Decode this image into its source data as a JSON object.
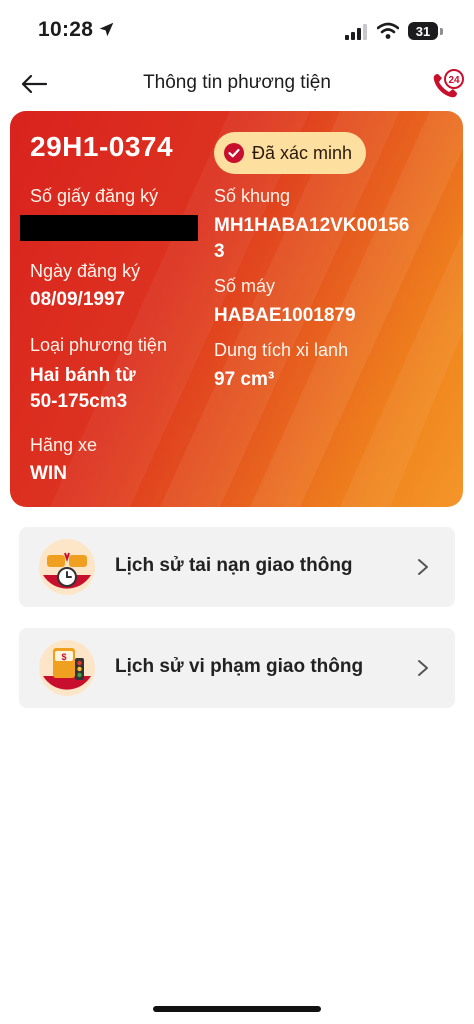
{
  "status_bar": {
    "time": "10:28",
    "battery": "31"
  },
  "nav": {
    "title": "Thông tin phương tiện",
    "hotline_badge": "24"
  },
  "vehicle": {
    "plate": "29H1-0374",
    "verified_label": "Đã xác minh",
    "reg_no_label": "Số giấy đăng ký",
    "reg_date_label": "Ngày đăng ký",
    "reg_date": "08/09/1997",
    "type_label": "Loại phương tiện",
    "type_line1": "Hai bánh từ",
    "type_line2": "50-175cm3",
    "brand_label": "Hãng xe",
    "brand": "WIN",
    "chassis_label": "Số khung",
    "chassis_line1": "MH1HABA12VK00156",
    "chassis_line2": "3",
    "engine_label": "Số máy",
    "engine": "HABAE1001879",
    "capacity_label": "Dung tích xi lanh",
    "capacity": "97 cm³"
  },
  "menu": [
    {
      "label": "Lịch sử tai nạn giao thông",
      "icon": "car-accident-icon"
    },
    {
      "label": "Lịch sử vi phạm giao thông",
      "icon": "traffic-violation-icon"
    }
  ],
  "colors": {
    "card_start": "#d9221e",
    "card_end": "#f4962a",
    "badge_bg": "#fde0a0",
    "accent_red": "#c8102e"
  }
}
